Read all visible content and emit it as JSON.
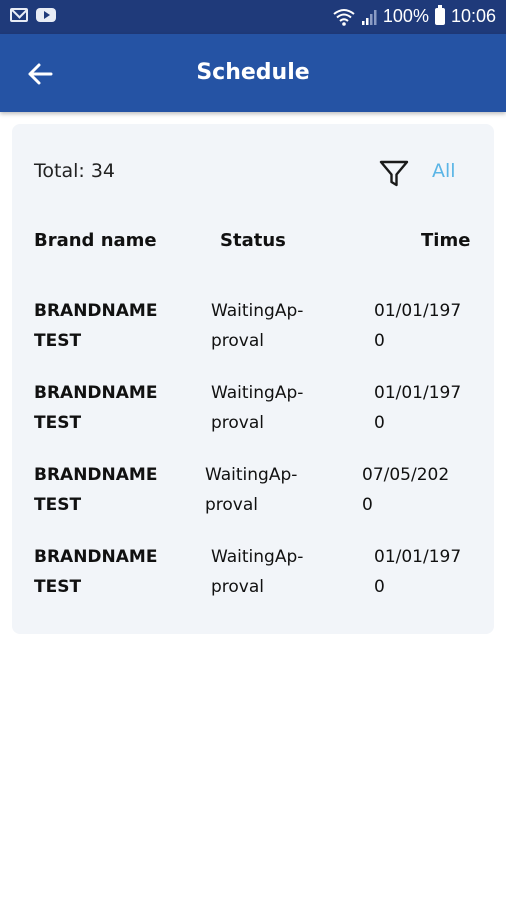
{
  "status_bar": {
    "battery": "100%",
    "time": "10:06",
    "icons": [
      "mail-icon",
      "youtube-icon",
      "wifi-icon",
      "signal-icon",
      "battery-icon"
    ]
  },
  "app_bar": {
    "title": "Schedule",
    "back_icon": "arrow-left-icon"
  },
  "summary": {
    "total_label": "Total: 34",
    "filter_icon": "filter-icon",
    "filter_value": "All"
  },
  "table": {
    "headers": [
      "Brand name",
      "Status",
      "Time"
    ],
    "rows": [
      {
        "brand": [
          "BRANDNAME",
          "TEST"
        ],
        "status": [
          "WaitingAp-",
          "proval"
        ],
        "time": [
          "01/01/197",
          "0"
        ]
      },
      {
        "brand": [
          "BRANDNAME",
          "TEST"
        ],
        "status": [
          "WaitingAp-",
          "proval"
        ],
        "time": [
          "01/01/197",
          "0"
        ]
      },
      {
        "brand": [
          "BRANDNAME",
          "TEST"
        ],
        "status": [
          "WaitingAp-",
          "proval"
        ],
        "time": [
          "07/05/202",
          "0"
        ]
      },
      {
        "brand": [
          "BRANDNAME",
          "TEST"
        ],
        "status": [
          "WaitingAp-",
          "proval"
        ],
        "time": [
          "01/01/197",
          "0"
        ]
      }
    ]
  },
  "colors": {
    "status_bar": "#1f3a7a",
    "app_bar": "#2553a4",
    "card_background": "#f2f5f9",
    "accent": "#5bb5e6"
  }
}
